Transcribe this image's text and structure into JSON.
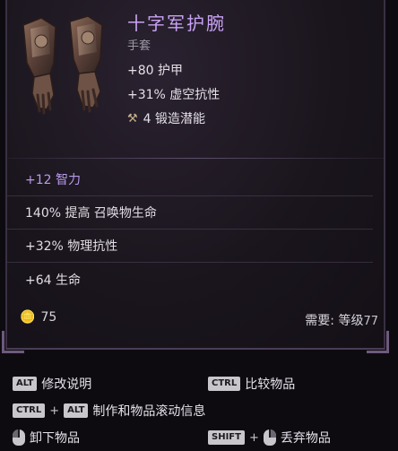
{
  "item": {
    "name": "十字军护腕",
    "type": "手套",
    "stats": [
      "+80 护甲",
      "+31% 虚空抗性"
    ],
    "forge_icon": "hammer-icon",
    "forge": "4 锻造潜能",
    "affixes": [
      {
        "text": "+12 智力",
        "special": true
      },
      {
        "text": "140% 提高 召唤物生命",
        "special": false
      },
      {
        "text": "+32% 物理抗性",
        "special": false
      },
      {
        "text": "+64 生命",
        "special": false
      }
    ],
    "gold_icon": "gold-coin-icon",
    "gold": "75",
    "requirement_label": "需要: 等级",
    "requirement_value": "77"
  },
  "hints": {
    "alt_key": "ALT",
    "alt_label": "修改说明",
    "ctrl_key": "CTRL",
    "ctrl_label": "比较物品",
    "ctrl2_key": "CTRL",
    "plus": "+",
    "alt2_key": "ALT",
    "ctrl_alt_label": "制作和物品滚动信息",
    "unequip_icon": "mouse-left-icon",
    "unequip_label": "卸下物品",
    "shift_key": "SHIFT",
    "drop_icon": "mouse-right-icon",
    "drop_label": "丢弃物品"
  },
  "colors": {
    "title": "#c9a2f5",
    "special_affix": "#b79ae8",
    "background": "#0d0b10"
  }
}
